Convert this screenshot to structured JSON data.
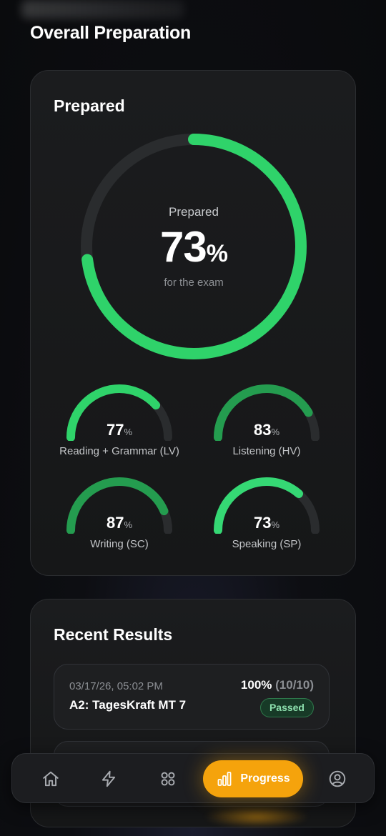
{
  "header": {
    "title": "Overall Preparation"
  },
  "prepared_card": {
    "title": "Prepared",
    "ring": {
      "label": "Prepared",
      "value": "73",
      "unit": "%",
      "subtitle": "for the exam",
      "progress_fraction": 0.73,
      "color": "#2fd36a"
    },
    "skills": [
      {
        "value": "77",
        "unit": "%",
        "label": "Reading + Grammar (LV)",
        "progress_fraction": 0.77
      },
      {
        "value": "83",
        "unit": "%",
        "label": "Listening (HV)",
        "progress_fraction": 0.83
      },
      {
        "value": "87",
        "unit": "%",
        "label": "Writing (SC)",
        "progress_fraction": 0.87
      },
      {
        "value": "73",
        "unit": "%",
        "label": "Speaking (SP)",
        "progress_fraction": 0.73
      }
    ]
  },
  "results_card": {
    "title": "Recent Results",
    "items": [
      {
        "date": "03/17/26, 05:02 PM",
        "name": "A2: TagesKraft MT 7",
        "score": "100%",
        "score_detail": "(10/10)",
        "status": "Passed"
      }
    ]
  },
  "nav": {
    "items": [
      {
        "icon": "home-icon"
      },
      {
        "icon": "lightning-icon"
      },
      {
        "icon": "grid-icon"
      },
      {
        "icon": "bar-chart-icon",
        "label": "Progress",
        "active": true
      },
      {
        "icon": "profile-icon"
      }
    ],
    "active_color": "#f5a30c"
  }
}
